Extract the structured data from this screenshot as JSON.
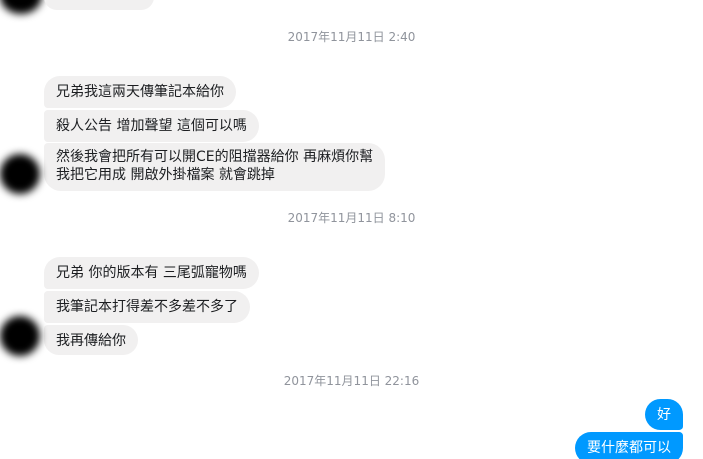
{
  "conversation": {
    "top_partial_message": "...",
    "timestamps": [
      "2017年11月11日 2:40",
      "2017年11月11日 8:10",
      "2017年11月11日 22:16"
    ],
    "group1": [
      "兄弟我這兩天傳筆記本給你",
      "殺人公告  增加聲望 這個可以嗎",
      "然後我會把所有可以開CE的阻擋器給你  再麻煩你幫",
      "我把它用成 開啟外掛檔案 就會跳掉"
    ],
    "group2": [
      "兄弟 你的版本有 三尾弧寵物嗎",
      "我筆記本打得差不多差不多了",
      "我再傳給你"
    ],
    "outgoing": [
      "好",
      "要什麼都可以"
    ]
  },
  "colors": {
    "incoming_bubble": "#f1f0f0",
    "outgoing_bubble": "#0099ff",
    "timestamp_text": "#90949c"
  }
}
